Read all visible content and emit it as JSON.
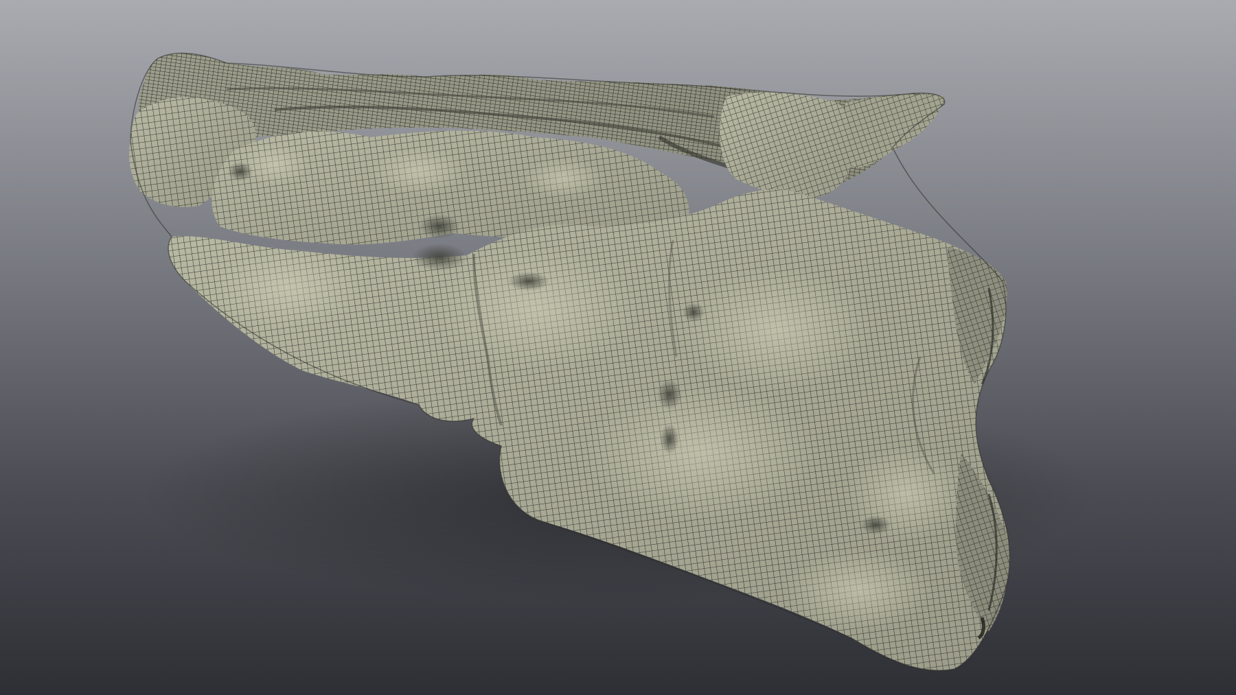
{
  "scene": {
    "description_visible_text": "",
    "colors": {
      "background_top": "#a6a8ae",
      "background_mid": "#6a6c73",
      "background_bottom": "#2f3036",
      "mesh_surface": "#a7a895",
      "mesh_surface_light": "#c4c4ab",
      "mesh_shadow": "#5d5f57",
      "wireframe": "#1e201c"
    }
  }
}
